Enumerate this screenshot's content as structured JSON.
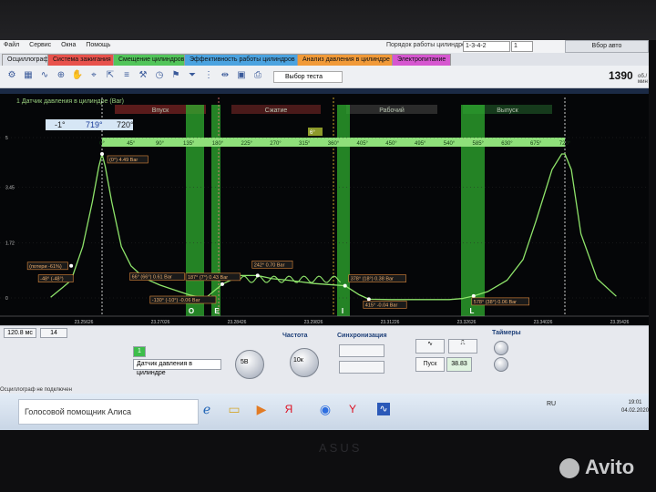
{
  "menu": [
    "Файл",
    "Сервис",
    "Окна",
    "Помощь"
  ],
  "order": {
    "label": "Порядок работы цилиндров",
    "value": "1-3-4-2",
    "cylinder": "1"
  },
  "autofit_label": "Вбор авто",
  "tabs": [
    {
      "label": "Осциллограф",
      "color": "#dfe2e8"
    },
    {
      "label": "Система зажигания",
      "color": "#e8524c"
    },
    {
      "label": "Смещение цилиндров",
      "color": "#52c55a"
    },
    {
      "label": "Эффективность работы цилиндров",
      "color": "#4ba3e0"
    },
    {
      "label": "Анализ давления в цилиндре",
      "color": "#f19a38"
    },
    {
      "label": "Электропитание",
      "color": "#d657d0"
    }
  ],
  "toolbar": {
    "view_select": "Выбор теста",
    "rpm": "1390",
    "rpm_unit": "об./мин"
  },
  "plot": {
    "channel_label": "1 Датчик давления в цилиндре (Bar)",
    "phase_labels": [
      "Впуск",
      "Сжатие",
      "Рабочий",
      "Выпуск"
    ],
    "marker_start": "-1°",
    "marker_end": "719°",
    "span": "720°",
    "cursor_angle": "6°",
    "y_ticks": [
      "5",
      "3.45",
      "1.72",
      "0"
    ],
    "deg_ticks": [
      "0°",
      "45°",
      "90°",
      "135°",
      "180°",
      "225°",
      "270°",
      "315°",
      "360°",
      "405°",
      "450°",
      "495°",
      "540°",
      "585°",
      "630°",
      "675°",
      "720°"
    ],
    "time_ticks": [
      "23.25626",
      "23.27026",
      "23.28426",
      "23.29826",
      "23.31226",
      "23.32626",
      "23.34026",
      "23.35426"
    ],
    "annotations": [
      {
        "text": "(0°) 4.49 Bar"
      },
      {
        "text": "(потери -61%)"
      },
      {
        "text": "-48° (-48°)"
      },
      {
        "text": "66° (66°) 0.61 Bar"
      },
      {
        "text": "187° (7°) 0.43 Bar"
      },
      {
        "text": "242° 0.70 Bar"
      },
      {
        "text": "378° (18°) 0.38 Bar"
      },
      {
        "text": "415° -0.04 Bar"
      },
      {
        "text": "-130° (-10°) -0.06 Bar"
      },
      {
        "text": "578° (38°) 0.06 Bar"
      }
    ],
    "events": [
      "O",
      "E",
      "I",
      "L"
    ]
  },
  "chart_data": {
    "type": "line",
    "title": "1 Датчик давления в цилиндре (Bar)",
    "xlabel": "",
    "ylabel": "",
    "ylim": [
      0,
      5
    ],
    "series": [
      {
        "name": "1 Датчик давления в цилиндре (Bar)",
        "x": [
          -80,
          -60,
          -48,
          -30,
          -15,
          -5,
          0,
          5,
          15,
          30,
          45,
          66,
          90,
          120,
          135,
          160,
          187,
          200,
          215,
          242,
          265,
          290,
          310,
          330,
          350,
          378,
          400,
          415,
          450,
          495,
          540,
          560,
          578,
          600,
          630,
          655,
          675,
          700,
          715,
          720,
          730,
          745,
          770,
          800
        ],
        "y": [
          0.02,
          0.35,
          0.55,
          1.6,
          3.0,
          4.1,
          4.49,
          4.1,
          3.0,
          1.6,
          1.0,
          0.61,
          0.4,
          0.2,
          0.1,
          -0.02,
          0.43,
          0.55,
          0.7,
          0.7,
          0.6,
          0.55,
          0.5,
          0.45,
          0.42,
          0.38,
          0.1,
          -0.04,
          -0.05,
          -0.05,
          -0.05,
          -0.02,
          0.06,
          0.2,
          0.55,
          1.2,
          2.4,
          4.0,
          4.49,
          4.49,
          4.0,
          2.0,
          0.6,
          0.05
        ]
      }
    ]
  },
  "controls": {
    "timebase": "120.8 мс",
    "trace": "14",
    "source_label": "Датчик давления в цилиндре",
    "range": "5В",
    "frequency_title": "Частота",
    "frequency_value": "10к",
    "sync_title": "Синхронизация",
    "timers_title": "Таймеры",
    "start_label": "Пуск",
    "fps": "38.83",
    "cyl_label": "1"
  },
  "status": "Осциллограф не подключен",
  "taskbar": {
    "assistant": "Голосовой помощник Алиса",
    "lang": "RU",
    "time": "19:01",
    "date": "04.02.2020"
  },
  "brand": "ASUS",
  "watermark": "Avito"
}
